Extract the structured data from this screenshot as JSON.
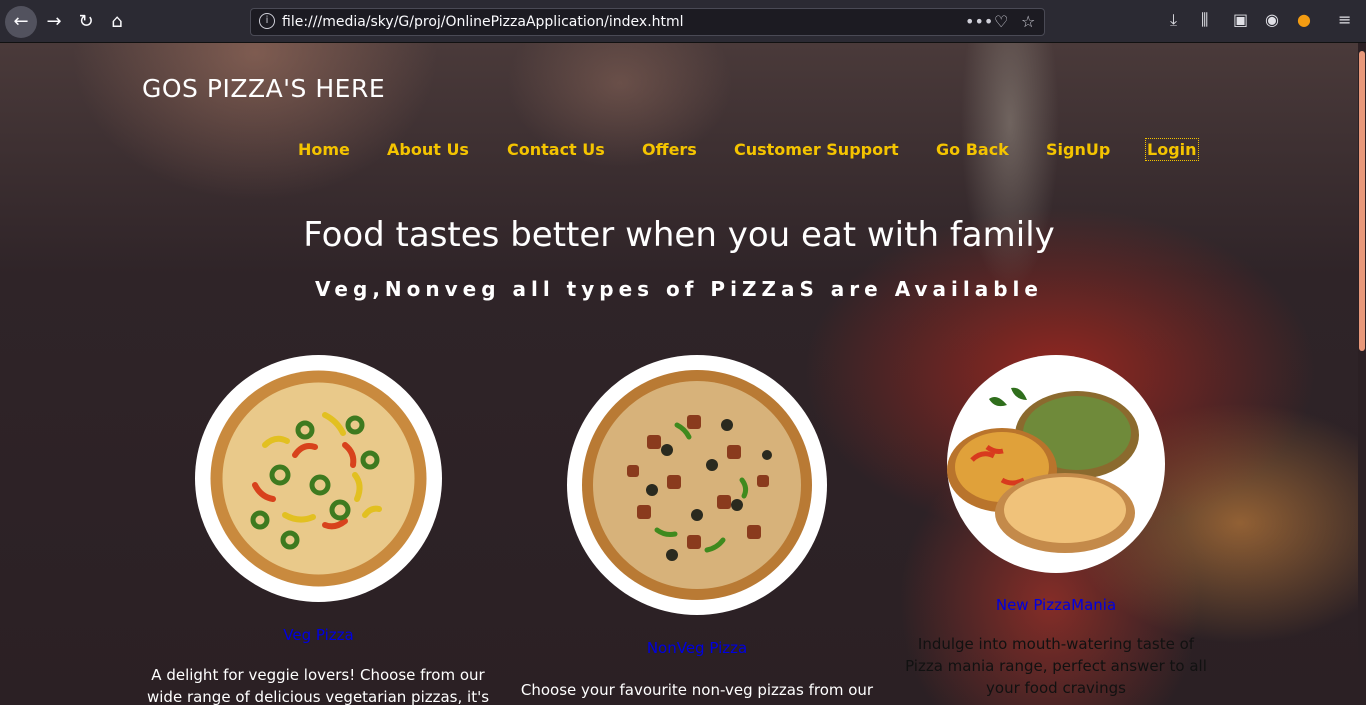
{
  "browser": {
    "url": "file:///media/sky/G/proj/OnlinePizzaApplication/index.html",
    "more_glyph": "•••"
  },
  "site": {
    "title": "GOS PIZZA'S HERE"
  },
  "nav": {
    "items": [
      "Home",
      "About Us",
      "Contact Us",
      "Offers",
      "Customer Support",
      "Go Back",
      "SignUp",
      "Login"
    ]
  },
  "hero": {
    "headline": "Food tastes better when you eat with family",
    "subline": "Veg,Nonveg all types of PiZZaS are Available"
  },
  "cards": [
    {
      "title": "Veg Pizza",
      "text_lines": [
        "A delight for veggie lovers! Choose from our",
        "wide range of delicious vegetarian pizzas, it's"
      ]
    },
    {
      "title": "NonVeg Pizza",
      "text_lines": [
        "Choose your favourite non-veg pizzas from our"
      ]
    },
    {
      "title": "New PizzaMania",
      "text_lines": [
        "Indulge into mouth-watering taste of",
        "Pizza mania range, perfect answer to all",
        "your food cravings"
      ]
    }
  ],
  "colors": {
    "nav": "#f4c400",
    "card_title": "#0000e0",
    "scroll_thumb": "#e8987a"
  }
}
